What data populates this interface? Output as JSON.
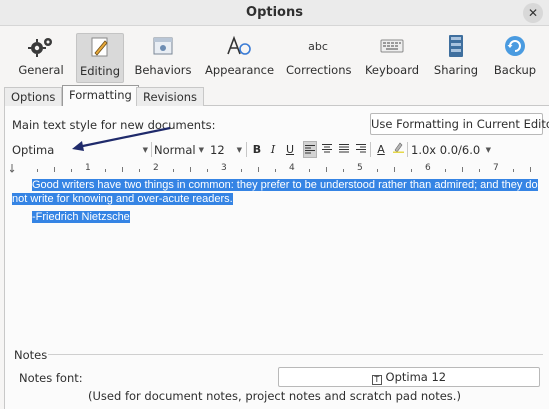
{
  "window": {
    "title": "Options",
    "close_glyph": "✕"
  },
  "toolbar": {
    "items": [
      {
        "label": "General",
        "icon": "gears-icon"
      },
      {
        "label": "Editing",
        "icon": "pencil-icon",
        "active": true
      },
      {
        "label": "Behaviors",
        "icon": "window-icon"
      },
      {
        "label": "Appearance",
        "icon": "font-a-icon"
      },
      {
        "label": "Corrections",
        "icon": "abc-icon",
        "icon_text": "abc"
      },
      {
        "label": "Keyboard",
        "icon": "keyboard-icon"
      },
      {
        "label": "Sharing",
        "icon": "book-icon"
      },
      {
        "label": "Backup",
        "icon": "backup-icon"
      }
    ]
  },
  "tabs": {
    "options": "Options",
    "formatting": "Formatting",
    "revisions": "Revisions"
  },
  "formatting": {
    "main_text_label": "Main text style for new documents:",
    "use_formatting_button": "Use Formatting in Current Editor",
    "font": "Optima",
    "style": "Normal",
    "size": "12",
    "bold": "B",
    "italic": "I",
    "underline": "U",
    "text_color_glyph": "A",
    "spacing": "1.0x 0.0/6.0",
    "ruler_numbers": [
      "1",
      "2",
      "3",
      "4",
      "5",
      "6",
      "7"
    ],
    "sample_paragraph": "Good writers have two things in common: they prefer to be understood rather than admired; and they do not write for knowing and over-acute readers.",
    "sample_attribution": "-Friedrich Nietzsche"
  },
  "notes": {
    "section_title": "Notes",
    "font_label": "Notes font:",
    "font_button": "Optima 12",
    "hint": "(Used for document notes, project notes and scratch pad notes.)"
  },
  "colors": {
    "selection": "#3584e4",
    "annotation_arrow": "#1f2a6b"
  }
}
